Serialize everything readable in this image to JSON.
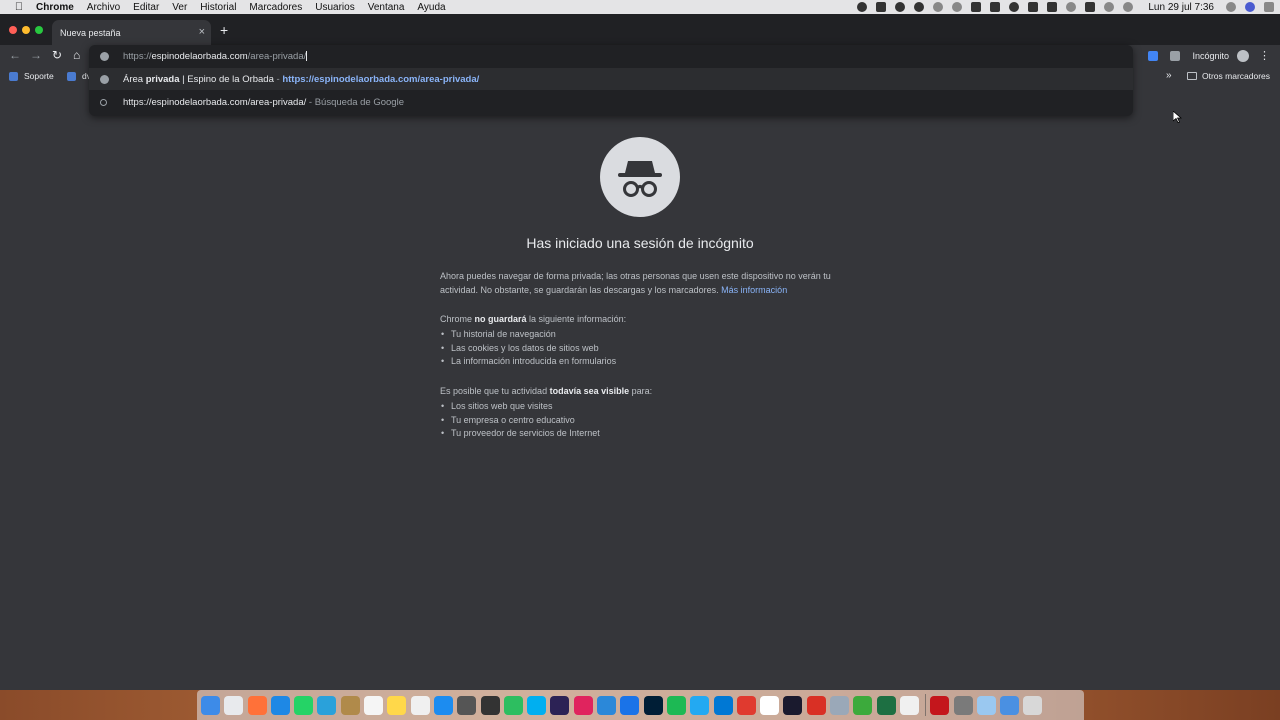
{
  "menubar": {
    "app_name": "Chrome",
    "items": [
      "Archivo",
      "Editar",
      "Ver",
      "Historial",
      "Marcadores",
      "Usuarios",
      "Ventana",
      "Ayuda"
    ],
    "clock": "Lun 29 jul  7:36"
  },
  "tab": {
    "title": "Nueva pestaña",
    "close": "×",
    "new_tab": "+"
  },
  "omnibox": {
    "input_scheme": "https://",
    "input_host": "espinodelaorbada.com",
    "input_path": "/area-privada/",
    "suggestion1": {
      "prefix": "Área ",
      "bold": "privada",
      "title_rest": " | Espino de la Orbada",
      "separator": " - ",
      "url": "https://espinodelaorbada.com/area-privada/"
    },
    "suggestion2": {
      "query": "https://espinodelaorbada.com/area-privada/",
      "separator": " - ",
      "engine": "Búsqueda de Google"
    }
  },
  "profile": {
    "label": "Incógnito"
  },
  "bookmarks": {
    "items": [
      "Soporte",
      "dv"
    ],
    "overflow": "»",
    "other": "Otros marcadores"
  },
  "content": {
    "heading": "Has iniciado una sesión de incógnito",
    "intro": "Ahora puedes navegar de forma privada; las otras personas que usen este dispositivo no verán tu actividad. No obstante, se guardarán las descargas y los marcadores.",
    "learn_more": "Más información",
    "not_saved_pre": "Chrome ",
    "not_saved_bold": "no guardará",
    "not_saved_post": " la siguiente información:",
    "not_saved_items": [
      "Tu historial de navegación",
      "Las cookies y los datos de sitios web",
      "La información introducida en formularios"
    ],
    "visible_pre": "Es posible que tu actividad ",
    "visible_bold": "todavía sea visible",
    "visible_post": " para:",
    "visible_items": [
      "Los sitios web que visites",
      "Tu empresa o centro educativo",
      "Tu proveedor de servicios de Internet"
    ]
  },
  "icons": {
    "apple": "apple-icon",
    "incognito": "incognito-icon",
    "back": "back-arrow-icon",
    "forward": "forward-arrow-icon",
    "reload": "reload-icon",
    "home": "home-icon"
  },
  "colors": {
    "page_bg": "#35363a",
    "tabstrip_bg": "#202124",
    "link": "#8ab4f8",
    "traffic_red": "#ff5f57",
    "traffic_yellow": "#febc2e",
    "traffic_green": "#28c840"
  },
  "dock_apps": [
    {
      "name": "finder",
      "color": "#3d8be8"
    },
    {
      "name": "chrome",
      "color": "#e8eaed"
    },
    {
      "name": "firefox",
      "color": "#ff7139"
    },
    {
      "name": "safari",
      "color": "#1e88e5"
    },
    {
      "name": "whatsapp",
      "color": "#25d366"
    },
    {
      "name": "telegram",
      "color": "#2aa1da"
    },
    {
      "name": "notes-brown",
      "color": "#b08a4a"
    },
    {
      "name": "calendar",
      "color": "#f5f5f5"
    },
    {
      "name": "notes",
      "color": "#ffd84a"
    },
    {
      "name": "textedit",
      "color": "#f0f0f0"
    },
    {
      "name": "app-store",
      "color": "#1c8cf0"
    },
    {
      "name": "disk-utility",
      "color": "#555555"
    },
    {
      "name": "system-tool",
      "color": "#333333"
    },
    {
      "name": "evernote",
      "color": "#2dbe60"
    },
    {
      "name": "skype",
      "color": "#00aff0"
    },
    {
      "name": "eclipse",
      "color": "#2c2255"
    },
    {
      "name": "app-red",
      "color": "#e0245e"
    },
    {
      "name": "wunderlist",
      "color": "#2b88d9"
    },
    {
      "name": "word-like",
      "color": "#1a73e8"
    },
    {
      "name": "photoshop",
      "color": "#001e36"
    },
    {
      "name": "spotify",
      "color": "#1db954"
    },
    {
      "name": "vscode",
      "color": "#23a9f2"
    },
    {
      "name": "windows-app",
      "color": "#0078d4"
    },
    {
      "name": "remote-app",
      "color": "#e03a2f"
    },
    {
      "name": "slack",
      "color": "#ffffff"
    },
    {
      "name": "app-dark",
      "color": "#1a1a2e"
    },
    {
      "name": "app-red-2",
      "color": "#d93025"
    },
    {
      "name": "app-circle",
      "color": "#9aa8b8"
    },
    {
      "name": "app-green",
      "color": "#3caa3c"
    },
    {
      "name": "excel",
      "color": "#1d6f42"
    },
    {
      "name": "emoji-app",
      "color": "#f0f0f0"
    },
    {
      "name": "app-k",
      "color": "#c4161c"
    },
    {
      "name": "archive",
      "color": "#7a7a7a"
    },
    {
      "name": "preview",
      "color": "#9ac8f0"
    },
    {
      "name": "downloads",
      "color": "#4a90e2"
    },
    {
      "name": "trash",
      "color": "#d8d8d8"
    }
  ]
}
